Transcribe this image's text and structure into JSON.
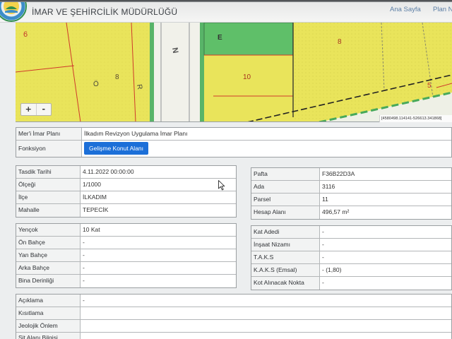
{
  "header": {
    "title": "İMAR VE ŞEHİRCİLİK MÜDÜRLÜĞÜ",
    "nav": [
      {
        "label": "Ana Sayfa"
      },
      {
        "label": "Plan N"
      }
    ]
  },
  "map": {
    "parcel_numbers": [
      "6",
      "8",
      "10",
      "8",
      "5"
    ],
    "street_letters": [
      "Ö",
      "R",
      "N",
      "E"
    ],
    "zoom_in": "+",
    "zoom_out": "-",
    "coordinates": "[4580498.114141-526613.341868]"
  },
  "plan_info": [
    {
      "label": "Mer'i İmar Planı",
      "value": "İlkadım Revizyon Uygulama İmar Planı"
    },
    {
      "label": "Fonksiyon",
      "value": "Gelişme Konut Alanı"
    }
  ],
  "approval_info": [
    {
      "label": "Tasdik Tarihi",
      "value": "4.11.2022 00:00:00"
    },
    {
      "label": "Ölçeği",
      "value": "1/1000"
    },
    {
      "label": "İlçe",
      "value": "İLKADIM"
    },
    {
      "label": "Mahalle",
      "value": "TEPECİK"
    }
  ],
  "parcel_info": [
    {
      "label": "Pafta",
      "value": "F36B22D3A"
    },
    {
      "label": "Ada",
      "value": "3116"
    },
    {
      "label": "Parsel",
      "value": "11"
    },
    {
      "label": "Hesap Alanı",
      "value": "496,57 m²"
    }
  ],
  "setback_info": [
    {
      "label": "Yençok",
      "value": "10 Kat"
    },
    {
      "label": "Ön Bahçe",
      "value": "-"
    },
    {
      "label": "Yan Bahçe",
      "value": "-"
    },
    {
      "label": "Arka Bahçe",
      "value": "-"
    },
    {
      "label": "Bina Derinliği",
      "value": "-"
    }
  ],
  "density_info": [
    {
      "label": "Kat Adedi",
      "value": "-"
    },
    {
      "label": "İnşaat Nizamı",
      "value": "-"
    },
    {
      "label": "T.A.K.S",
      "value": "-"
    },
    {
      "label": "K.A.K.S (Emsal)",
      "value": "- (1,80)"
    },
    {
      "label": "Kot Alınacak Nokta",
      "value": "-"
    }
  ],
  "notes": [
    {
      "label": "Açıklama",
      "value": "-"
    },
    {
      "label": "Kısıtlama",
      "value": ""
    },
    {
      "label": "Jeolojik Önlem",
      "value": ""
    },
    {
      "label": "Sit Alanı Bilgisi",
      "value": ""
    }
  ],
  "colors": {
    "function_button": "#1c6fd8",
    "map_residential_yellow": "#e9e45b",
    "map_green_parcel": "#5fbf69",
    "map_boundary_red": "#cf3a2b",
    "nav_link": "#5c7fa6"
  },
  "icons": {
    "logo": "municipality-seal-icon",
    "cursor": "mouse-cursor-icon",
    "zoom_in": "plus-icon",
    "zoom_out": "minus-icon"
  }
}
